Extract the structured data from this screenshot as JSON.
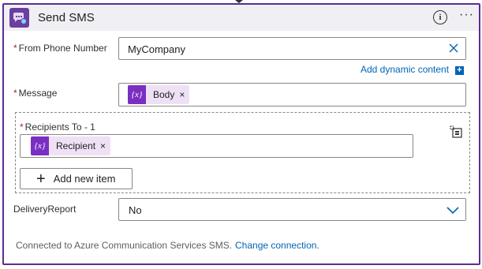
{
  "header": {
    "title": "Send SMS",
    "info_icon": "info-icon",
    "more_icon": "more-options-icon"
  },
  "fields": {
    "from": {
      "label": "From Phone Number",
      "required": "*",
      "value": "MyCompany"
    },
    "dynamic_content_link": "Add dynamic content",
    "dynamic_content_plus": "+",
    "message": {
      "label": "Message",
      "required": "*",
      "token": {
        "icon_text": "{x}",
        "label": "Body",
        "remove": "×"
      }
    },
    "recipients": {
      "label": "Recipients To - 1",
      "required": "*",
      "token": {
        "icon_text": "{x}",
        "label": "Recipient",
        "remove": "×"
      },
      "add_button": "Add new item",
      "add_plus": "+"
    },
    "delivery_report": {
      "label": "DeliveryReport",
      "value": "No"
    }
  },
  "footer": {
    "connected_text": "Connected to Azure Communication Services SMS.",
    "change_link": "Change connection."
  },
  "colors": {
    "accent": "#5c2d91",
    "token_bg": "#eee1f6",
    "token_icon": "#7a2fc2",
    "link": "#0064b4",
    "required": "#a4262c"
  }
}
